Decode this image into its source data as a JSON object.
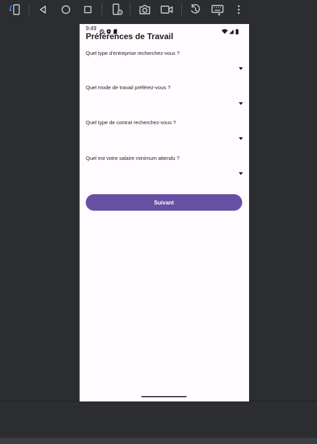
{
  "toolbar": {
    "icons": [
      "rotate-icon",
      "back-icon",
      "home-icon",
      "overview-icon",
      "device-settings-icon",
      "camera-icon",
      "video-icon",
      "snapshot-icon",
      "keyboard-icon",
      "more-icon"
    ]
  },
  "status": {
    "time": "9:49"
  },
  "screen": {
    "title": "Préférences de Travail",
    "questions": [
      {
        "label": "Quel type d'entreprise recherchez-vous ?",
        "value": ""
      },
      {
        "label": "Quel mode de travail préférez-vous ?",
        "value": ""
      },
      {
        "label": "Quel type de contrat recherchez-vous ?",
        "value": ""
      },
      {
        "label": "Quel est votre salaire minimum attendu ?",
        "value": ""
      }
    ],
    "next_label": "Suivant"
  },
  "colors": {
    "primary": "#6750a4",
    "surface": "#fffbfe",
    "ide_background": "#2b2d30",
    "icon_light": "#cfd2d6",
    "accent_blue": "#4a8cff"
  }
}
